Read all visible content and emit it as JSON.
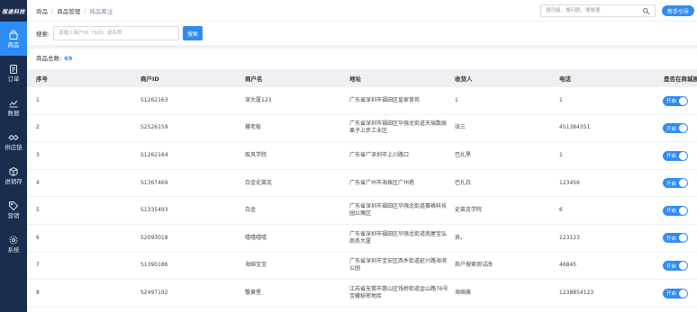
{
  "brand": {
    "logo_text": "视途科技"
  },
  "sidebar": {
    "items": [
      {
        "label": "商品",
        "icon": "bag-icon",
        "active": true
      },
      {
        "label": "订单",
        "icon": "order-icon"
      },
      {
        "label": "数据",
        "icon": "chart-icon"
      },
      {
        "label": "供应链",
        "icon": "handshake-icon"
      },
      {
        "label": "进销存",
        "icon": "inventory-icon"
      },
      {
        "label": "营销",
        "icon": "tag-icon"
      },
      {
        "label": "系统",
        "icon": "gear-icon"
      }
    ]
  },
  "header": {
    "breadcrumb": [
      "商品",
      "商品管理",
      "商品筹注"
    ],
    "search_placeholder": "搜功能、搜问题、搜単据",
    "guide_label": "新手引导"
  },
  "filter": {
    "label": "搜索:",
    "input_placeholder": "请输入商户ID（SID）或名称",
    "search_button": "搜索"
  },
  "summary": {
    "label": "商品总数:",
    "count": "69"
  },
  "table": {
    "columns": [
      "序号",
      "商户ID",
      "商户名",
      "地址",
      "收货人",
      "电话",
      "是否在商城展"
    ],
    "toggle_label": "开启",
    "rows": [
      {
        "idx": "1",
        "sid": "S1262163",
        "name": "深大厦123",
        "addr": "广东省深圳市福田区皇家草苑",
        "recipient": "1",
        "phone": "1"
      },
      {
        "idx": "2",
        "sid": "S2526159",
        "name": "饕老板",
        "addr": "广东省深圳市福田区华强北街道天瑞数娱果子上步工业区",
        "recipient": "张三",
        "phone": "451384351"
      },
      {
        "idx": "3",
        "sid": "S1262164",
        "name": "疾风学院",
        "addr": "广东省广深圳市上川路口",
        "recipient": "巴扎黑",
        "phone": "1"
      },
      {
        "idx": "4",
        "sid": "S1367469",
        "name": "白金史莱克",
        "addr": "广东省广州市海珠区广州塔",
        "recipient": "巴扎白",
        "phone": "123456"
      },
      {
        "idx": "5",
        "sid": "S1335493",
        "name": "白金",
        "addr": "广东省深圳市福田区华强北街道赛格科技园公寓区",
        "recipient": "史莱克学院",
        "phone": "6"
      },
      {
        "idx": "6",
        "sid": "S2093018",
        "name": "嘻嘻嘻嘻",
        "addr": "广东省深圳市福田区华强北街道南屋宝弘商务大厦",
        "recipient": "哀。",
        "phone": "123123"
      },
      {
        "idx": "7",
        "sid": "S1390186",
        "name": "海绵宝宝",
        "addr": "广东省深圳市宝安区西乡街道延兴路海滨公园",
        "recipient": "商户搜索测试改",
        "phone": "46845"
      },
      {
        "idx": "8",
        "sid": "S2497192",
        "name": "蟹黄堡",
        "addr": "江苏省无锡市惠山区钱桥街道金山路76号宝藏秘密地库",
        "recipient": "海绵酱",
        "phone": "1238854123"
      }
    ]
  },
  "colors": {
    "sidebar_bg": "#1a2d4f",
    "accent": "#2f8cf5"
  }
}
